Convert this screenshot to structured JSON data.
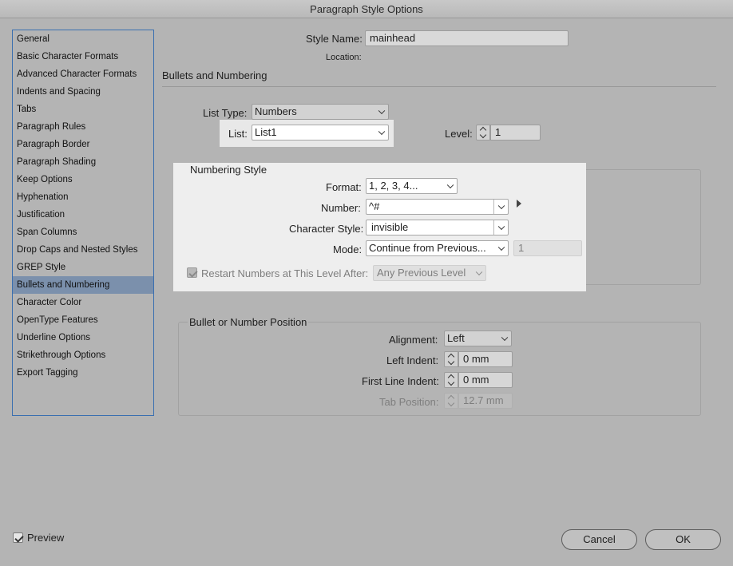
{
  "window": {
    "title": "Paragraph Style Options"
  },
  "sidebar": {
    "items": [
      {
        "label": "General"
      },
      {
        "label": "Basic Character Formats"
      },
      {
        "label": "Advanced Character Formats"
      },
      {
        "label": "Indents and Spacing"
      },
      {
        "label": "Tabs"
      },
      {
        "label": "Paragraph Rules"
      },
      {
        "label": "Paragraph Border"
      },
      {
        "label": "Paragraph Shading"
      },
      {
        "label": "Keep Options"
      },
      {
        "label": "Hyphenation"
      },
      {
        "label": "Justification"
      },
      {
        "label": "Span Columns"
      },
      {
        "label": "Drop Caps and Nested Styles"
      },
      {
        "label": "GREP Style"
      },
      {
        "label": "Bullets and Numbering"
      },
      {
        "label": "Character Color"
      },
      {
        "label": "OpenType Features"
      },
      {
        "label": "Underline Options"
      },
      {
        "label": "Strikethrough Options"
      },
      {
        "label": "Export Tagging"
      }
    ],
    "selected_index": 14
  },
  "header": {
    "style_name_label": "Style Name:",
    "style_name_value": "mainhead",
    "location_label": "Location:",
    "section_title": "Bullets and Numbering"
  },
  "list_type": {
    "label": "List Type:",
    "value": "Numbers"
  },
  "list": {
    "label": "List:",
    "value": "List1"
  },
  "level": {
    "label": "Level:",
    "value": "1"
  },
  "numbering_style": {
    "title": "Numbering Style",
    "format_label": "Format:",
    "format_value": "1, 2, 3, 4...",
    "number_label": "Number:",
    "number_value": "^#",
    "char_style_label": "Character Style:",
    "char_style_value": "invisible",
    "mode_label": "Mode:",
    "mode_value": "Continue from Previous...",
    "mode_number": "1",
    "restart_label": "Restart Numbers at This Level After:",
    "restart_value": "Any Previous Level",
    "restart_checked": true
  },
  "position": {
    "title": "Bullet or Number Position",
    "alignment_label": "Alignment:",
    "alignment_value": "Left",
    "left_indent_label": "Left Indent:",
    "left_indent_value": "0 mm",
    "first_line_label": "First Line Indent:",
    "first_line_value": "0 mm",
    "tab_position_label": "Tab Position:",
    "tab_position_value": "12.7 mm"
  },
  "footer": {
    "preview_label": "Preview",
    "preview_checked": true,
    "cancel_label": "Cancel",
    "ok_label": "OK"
  },
  "colors": {
    "background": "#b4b4b4",
    "sidebar_border": "#3a6fb0",
    "selected_item": "#7b90ac",
    "highlight": "#e8e8e8"
  }
}
